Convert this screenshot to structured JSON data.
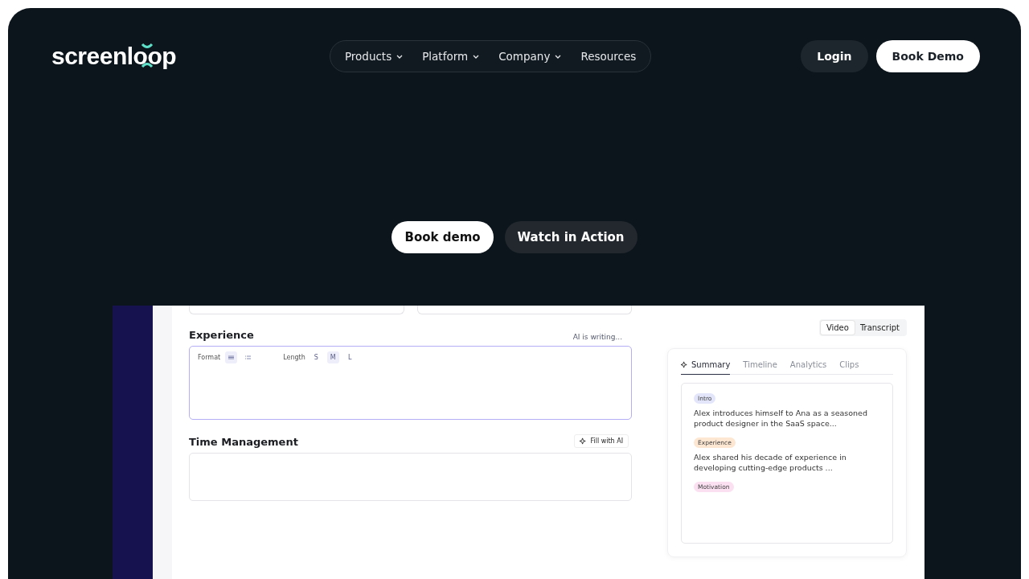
{
  "nav": {
    "logo": "screenloop",
    "menu": [
      {
        "label": "Products",
        "dropdown": true
      },
      {
        "label": "Platform",
        "dropdown": true
      },
      {
        "label": "Company",
        "dropdown": true
      },
      {
        "label": "Resources",
        "dropdown": false
      }
    ],
    "login": "Login",
    "book": "Book Demo"
  },
  "hero": {
    "buttons": [
      {
        "label": "Book demo",
        "kind": "primary"
      },
      {
        "label": "Watch in Action",
        "kind": "secondary"
      }
    ]
  },
  "form": {
    "sections": [
      {
        "title": "Experience",
        "kind": "editor",
        "status": "AI is writing...",
        "toolbar": {
          "format_label": "Format",
          "formats": [
            {
              "kind": "paragraph",
              "selected": true
            },
            {
              "kind": "list",
              "selected": false
            }
          ],
          "length_label": "Length",
          "lengths": [
            {
              "label": "S",
              "selected": false
            },
            {
              "label": "M",
              "selected": true
            },
            {
              "label": "L",
              "selected": false
            }
          ]
        }
      },
      {
        "title": "Time Management",
        "kind": "plain",
        "action": "Fill with AI"
      }
    ]
  },
  "side": {
    "views": [
      {
        "label": "Video",
        "selected": true
      },
      {
        "label": "Transcript",
        "selected": false
      }
    ],
    "tabs": [
      {
        "label": "Summary",
        "selected": true
      },
      {
        "label": "Timeline",
        "selected": false
      },
      {
        "label": "Analytics",
        "selected": false
      },
      {
        "label": "Clips",
        "selected": false
      }
    ],
    "summary": [
      {
        "tag": "Intro",
        "color": "#e3e6fb",
        "text": "Alex introduces himself to Ana as a seasoned product designer in the SaaS space..."
      },
      {
        "tag": "Experience",
        "color": "#fde7d2",
        "text": "Alex shared his decade of experience in developing cutting-edge products ..."
      },
      {
        "tag": "Motivation",
        "color": "#fbe0f1"
      }
    ]
  }
}
